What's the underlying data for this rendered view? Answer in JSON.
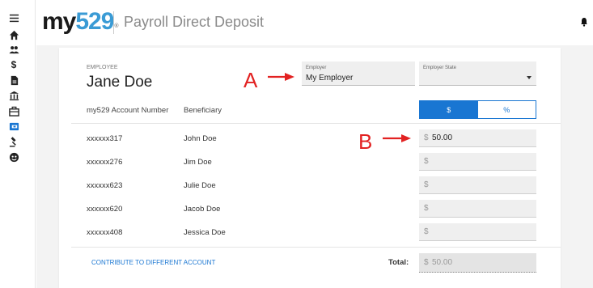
{
  "app": {
    "logo_my": "my",
    "logo_num": "529",
    "logo_reg": "®",
    "page_title": "Payroll Direct Deposit"
  },
  "sidebar": {
    "icons": [
      "menu-icon",
      "home-icon",
      "people-icon",
      "dollar-icon",
      "document-icon",
      "bank-icon",
      "briefcase-icon",
      "payroll-icon",
      "gavel-icon",
      "support-icon"
    ],
    "active": "payroll-icon",
    "dollar_glyph": "$"
  },
  "employee": {
    "label": "EMPLOYEE",
    "name": "Jane Doe"
  },
  "employer_field": {
    "label": "Employer",
    "value": "My Employer"
  },
  "employer_state_field": {
    "label": "Employer State",
    "value": ""
  },
  "table": {
    "headers": {
      "account": "my529 Account Number",
      "beneficiary": "Beneficiary"
    },
    "mode_toggle": {
      "dollar": "$",
      "percent": "%",
      "selected": "$"
    },
    "rows": [
      {
        "account": "xxxxxx317",
        "beneficiary": "John Doe",
        "currency": "$",
        "amount": "50.00"
      },
      {
        "account": "xxxxxx276",
        "beneficiary": "Jim Doe",
        "currency": "$",
        "amount": ""
      },
      {
        "account": "xxxxxx623",
        "beneficiary": "Julie Doe",
        "currency": "$",
        "amount": ""
      },
      {
        "account": "xxxxxx620",
        "beneficiary": "Jacob Doe",
        "currency": "$",
        "amount": ""
      },
      {
        "account": "xxxxxx408",
        "beneficiary": "Jessica Doe",
        "currency": "$",
        "amount": ""
      }
    ]
  },
  "footer": {
    "contribute_link": "CONTRIBUTE TO DIFFERENT ACCOUNT",
    "total_label": "Total:",
    "total_currency": "$",
    "total_value": "50.00"
  },
  "annotations": {
    "a": "A",
    "b": "B",
    "color": "#e22222"
  },
  "colors": {
    "accent": "#1976d2",
    "logo_blue": "#3a9bd5"
  }
}
